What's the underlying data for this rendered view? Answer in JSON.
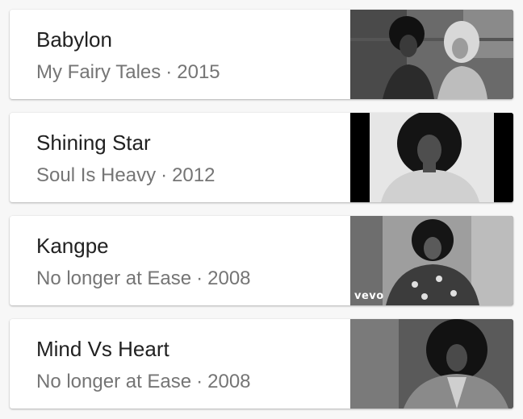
{
  "tracks": [
    {
      "title": "Babylon",
      "album": "My Fairy Tales",
      "separator": "·",
      "year": "2015",
      "thumbnail": "two-people-photo"
    },
    {
      "title": "Shining Star",
      "album": "Soul Is Heavy",
      "separator": "·",
      "year": "2012",
      "thumbnail": "portrait-afro-photo"
    },
    {
      "title": "Kangpe",
      "album": "No longer at Ease",
      "separator": "·",
      "year": "2008",
      "thumbnail": "video-still-photo",
      "watermark": "vevo"
    },
    {
      "title": "Mind Vs Heart",
      "album": "No longer at Ease",
      "separator": "·",
      "year": "2008",
      "thumbnail": "portrait-photo"
    }
  ]
}
